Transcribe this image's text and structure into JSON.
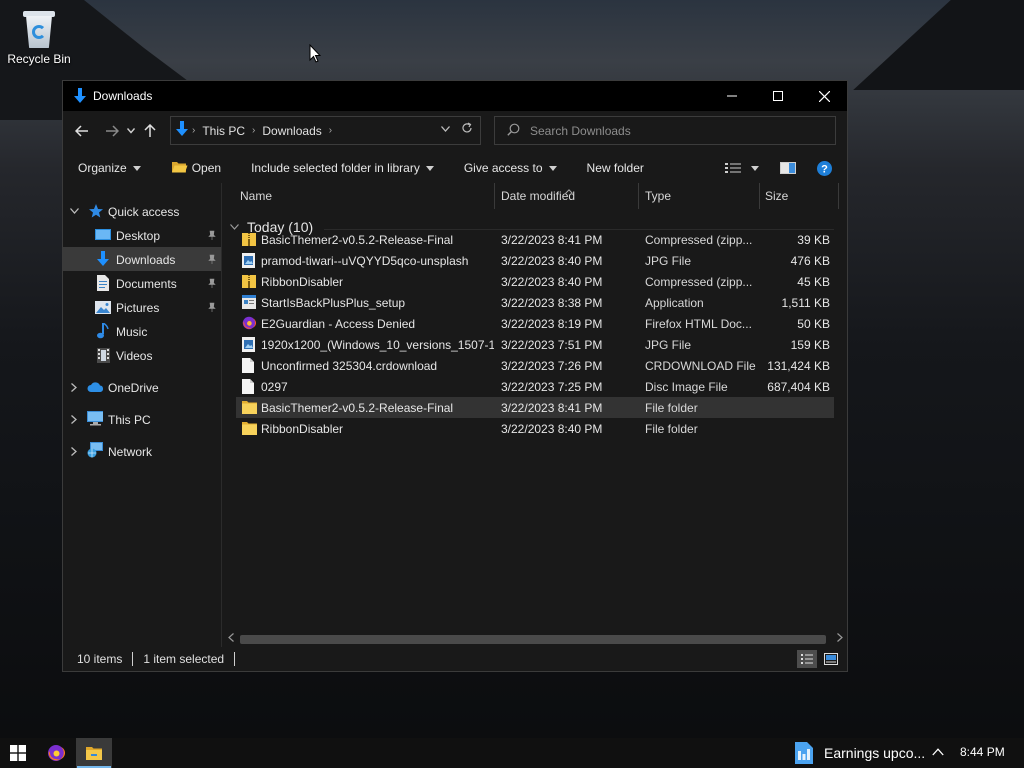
{
  "desktop": {
    "recycle_bin_label": "Recycle Bin"
  },
  "window": {
    "title": "Downloads",
    "controls": {
      "minimize": "minimize",
      "maximize": "maximize",
      "close": "close"
    }
  },
  "address": {
    "crumbs": [
      "This PC",
      "Downloads"
    ]
  },
  "search": {
    "placeholder": "Search Downloads"
  },
  "toolbar": {
    "organize": "Organize",
    "open": "Open",
    "include": "Include selected folder in library",
    "give_access": "Give access to",
    "new_folder": "New folder"
  },
  "nav": {
    "quick_access": "Quick access",
    "desktop": "Desktop",
    "downloads": "Downloads",
    "documents": "Documents",
    "pictures": "Pictures",
    "music": "Music",
    "videos": "Videos",
    "onedrive": "OneDrive",
    "this_pc": "This PC",
    "network": "Network"
  },
  "columns": {
    "name": "Name",
    "date": "Date modified",
    "type": "Type",
    "size": "Size"
  },
  "group": {
    "label": "Today (10)"
  },
  "files": [
    {
      "name": "BasicThemer2-v0.5.2-Release-Final",
      "date": "3/22/2023 8:41 PM",
      "type": "Compressed (zipp...",
      "size": "39 KB",
      "icon": "zip-folder-icon"
    },
    {
      "name": "pramod-tiwari--uVQYYD5qco-unsplash",
      "date": "3/22/2023 8:40 PM",
      "type": "JPG File",
      "size": "476 KB",
      "icon": "image-file-icon"
    },
    {
      "name": "RibbonDisabler",
      "date": "3/22/2023 8:40 PM",
      "type": "Compressed (zipp...",
      "size": "45 KB",
      "icon": "zip-folder-icon"
    },
    {
      "name": "StartIsBackPlusPlus_setup",
      "date": "3/22/2023 8:38 PM",
      "type": "Application",
      "size": "1,511 KB",
      "icon": "application-icon"
    },
    {
      "name": "E2Guardian - Access Denied",
      "date": "3/22/2023 8:19 PM",
      "type": "Firefox HTML Doc...",
      "size": "50 KB",
      "icon": "firefox-html-icon"
    },
    {
      "name": "1920x1200_(Windows_10_versions_1507-1...",
      "date": "3/22/2023 7:51 PM",
      "type": "JPG File",
      "size": "159 KB",
      "icon": "image-file-icon"
    },
    {
      "name": "Unconfirmed 325304.crdownload",
      "date": "3/22/2023 7:26 PM",
      "type": "CRDOWNLOAD File",
      "size": "131,424 KB",
      "icon": "blank-file-icon"
    },
    {
      "name": "0297",
      "date": "3/22/2023 7:25 PM",
      "type": "Disc Image File",
      "size": "687,404 KB",
      "icon": "blank-file-icon"
    },
    {
      "name": "BasicThemer2-v0.5.2-Release-Final",
      "date": "3/22/2023 8:41 PM",
      "type": "File folder",
      "size": "",
      "icon": "folder-icon",
      "selected": true
    },
    {
      "name": "RibbonDisabler",
      "date": "3/22/2023 8:40 PM",
      "type": "File folder",
      "size": "",
      "icon": "folder-icon"
    }
  ],
  "status": {
    "count": "10 items",
    "selected": "1 item selected"
  },
  "taskbar": {
    "news": "Earnings upco...",
    "time": "8:44 PM"
  },
  "colors": {
    "accent_blue": "#1e90ff",
    "folder_yellow": "#f3c744"
  }
}
